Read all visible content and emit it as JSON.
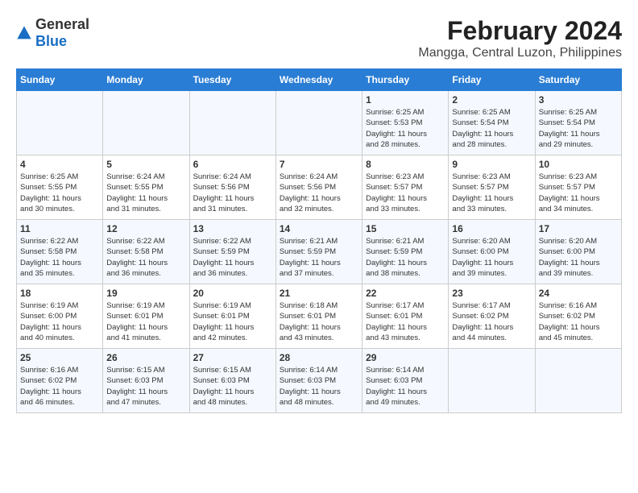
{
  "header": {
    "logo_general": "General",
    "logo_blue": "Blue",
    "title": "February 2024",
    "subtitle": "Mangga, Central Luzon, Philippines"
  },
  "calendar": {
    "days_of_week": [
      "Sunday",
      "Monday",
      "Tuesday",
      "Wednesday",
      "Thursday",
      "Friday",
      "Saturday"
    ],
    "weeks": [
      [
        {
          "day": "",
          "content": ""
        },
        {
          "day": "",
          "content": ""
        },
        {
          "day": "",
          "content": ""
        },
        {
          "day": "",
          "content": ""
        },
        {
          "day": "1",
          "content": "Sunrise: 6:25 AM\nSunset: 5:53 PM\nDaylight: 11 hours\nand 28 minutes."
        },
        {
          "day": "2",
          "content": "Sunrise: 6:25 AM\nSunset: 5:54 PM\nDaylight: 11 hours\nand 28 minutes."
        },
        {
          "day": "3",
          "content": "Sunrise: 6:25 AM\nSunset: 5:54 PM\nDaylight: 11 hours\nand 29 minutes."
        }
      ],
      [
        {
          "day": "4",
          "content": "Sunrise: 6:25 AM\nSunset: 5:55 PM\nDaylight: 11 hours\nand 30 minutes."
        },
        {
          "day": "5",
          "content": "Sunrise: 6:24 AM\nSunset: 5:55 PM\nDaylight: 11 hours\nand 31 minutes."
        },
        {
          "day": "6",
          "content": "Sunrise: 6:24 AM\nSunset: 5:56 PM\nDaylight: 11 hours\nand 31 minutes."
        },
        {
          "day": "7",
          "content": "Sunrise: 6:24 AM\nSunset: 5:56 PM\nDaylight: 11 hours\nand 32 minutes."
        },
        {
          "day": "8",
          "content": "Sunrise: 6:23 AM\nSunset: 5:57 PM\nDaylight: 11 hours\nand 33 minutes."
        },
        {
          "day": "9",
          "content": "Sunrise: 6:23 AM\nSunset: 5:57 PM\nDaylight: 11 hours\nand 33 minutes."
        },
        {
          "day": "10",
          "content": "Sunrise: 6:23 AM\nSunset: 5:57 PM\nDaylight: 11 hours\nand 34 minutes."
        }
      ],
      [
        {
          "day": "11",
          "content": "Sunrise: 6:22 AM\nSunset: 5:58 PM\nDaylight: 11 hours\nand 35 minutes."
        },
        {
          "day": "12",
          "content": "Sunrise: 6:22 AM\nSunset: 5:58 PM\nDaylight: 11 hours\nand 36 minutes."
        },
        {
          "day": "13",
          "content": "Sunrise: 6:22 AM\nSunset: 5:59 PM\nDaylight: 11 hours\nand 36 minutes."
        },
        {
          "day": "14",
          "content": "Sunrise: 6:21 AM\nSunset: 5:59 PM\nDaylight: 11 hours\nand 37 minutes."
        },
        {
          "day": "15",
          "content": "Sunrise: 6:21 AM\nSunset: 5:59 PM\nDaylight: 11 hours\nand 38 minutes."
        },
        {
          "day": "16",
          "content": "Sunrise: 6:20 AM\nSunset: 6:00 PM\nDaylight: 11 hours\nand 39 minutes."
        },
        {
          "day": "17",
          "content": "Sunrise: 6:20 AM\nSunset: 6:00 PM\nDaylight: 11 hours\nand 39 minutes."
        }
      ],
      [
        {
          "day": "18",
          "content": "Sunrise: 6:19 AM\nSunset: 6:00 PM\nDaylight: 11 hours\nand 40 minutes."
        },
        {
          "day": "19",
          "content": "Sunrise: 6:19 AM\nSunset: 6:01 PM\nDaylight: 11 hours\nand 41 minutes."
        },
        {
          "day": "20",
          "content": "Sunrise: 6:19 AM\nSunset: 6:01 PM\nDaylight: 11 hours\nand 42 minutes."
        },
        {
          "day": "21",
          "content": "Sunrise: 6:18 AM\nSunset: 6:01 PM\nDaylight: 11 hours\nand 43 minutes."
        },
        {
          "day": "22",
          "content": "Sunrise: 6:17 AM\nSunset: 6:01 PM\nDaylight: 11 hours\nand 43 minutes."
        },
        {
          "day": "23",
          "content": "Sunrise: 6:17 AM\nSunset: 6:02 PM\nDaylight: 11 hours\nand 44 minutes."
        },
        {
          "day": "24",
          "content": "Sunrise: 6:16 AM\nSunset: 6:02 PM\nDaylight: 11 hours\nand 45 minutes."
        }
      ],
      [
        {
          "day": "25",
          "content": "Sunrise: 6:16 AM\nSunset: 6:02 PM\nDaylight: 11 hours\nand 46 minutes."
        },
        {
          "day": "26",
          "content": "Sunrise: 6:15 AM\nSunset: 6:03 PM\nDaylight: 11 hours\nand 47 minutes."
        },
        {
          "day": "27",
          "content": "Sunrise: 6:15 AM\nSunset: 6:03 PM\nDaylight: 11 hours\nand 48 minutes."
        },
        {
          "day": "28",
          "content": "Sunrise: 6:14 AM\nSunset: 6:03 PM\nDaylight: 11 hours\nand 48 minutes."
        },
        {
          "day": "29",
          "content": "Sunrise: 6:14 AM\nSunset: 6:03 PM\nDaylight: 11 hours\nand 49 minutes."
        },
        {
          "day": "",
          "content": ""
        },
        {
          "day": "",
          "content": ""
        }
      ]
    ]
  }
}
